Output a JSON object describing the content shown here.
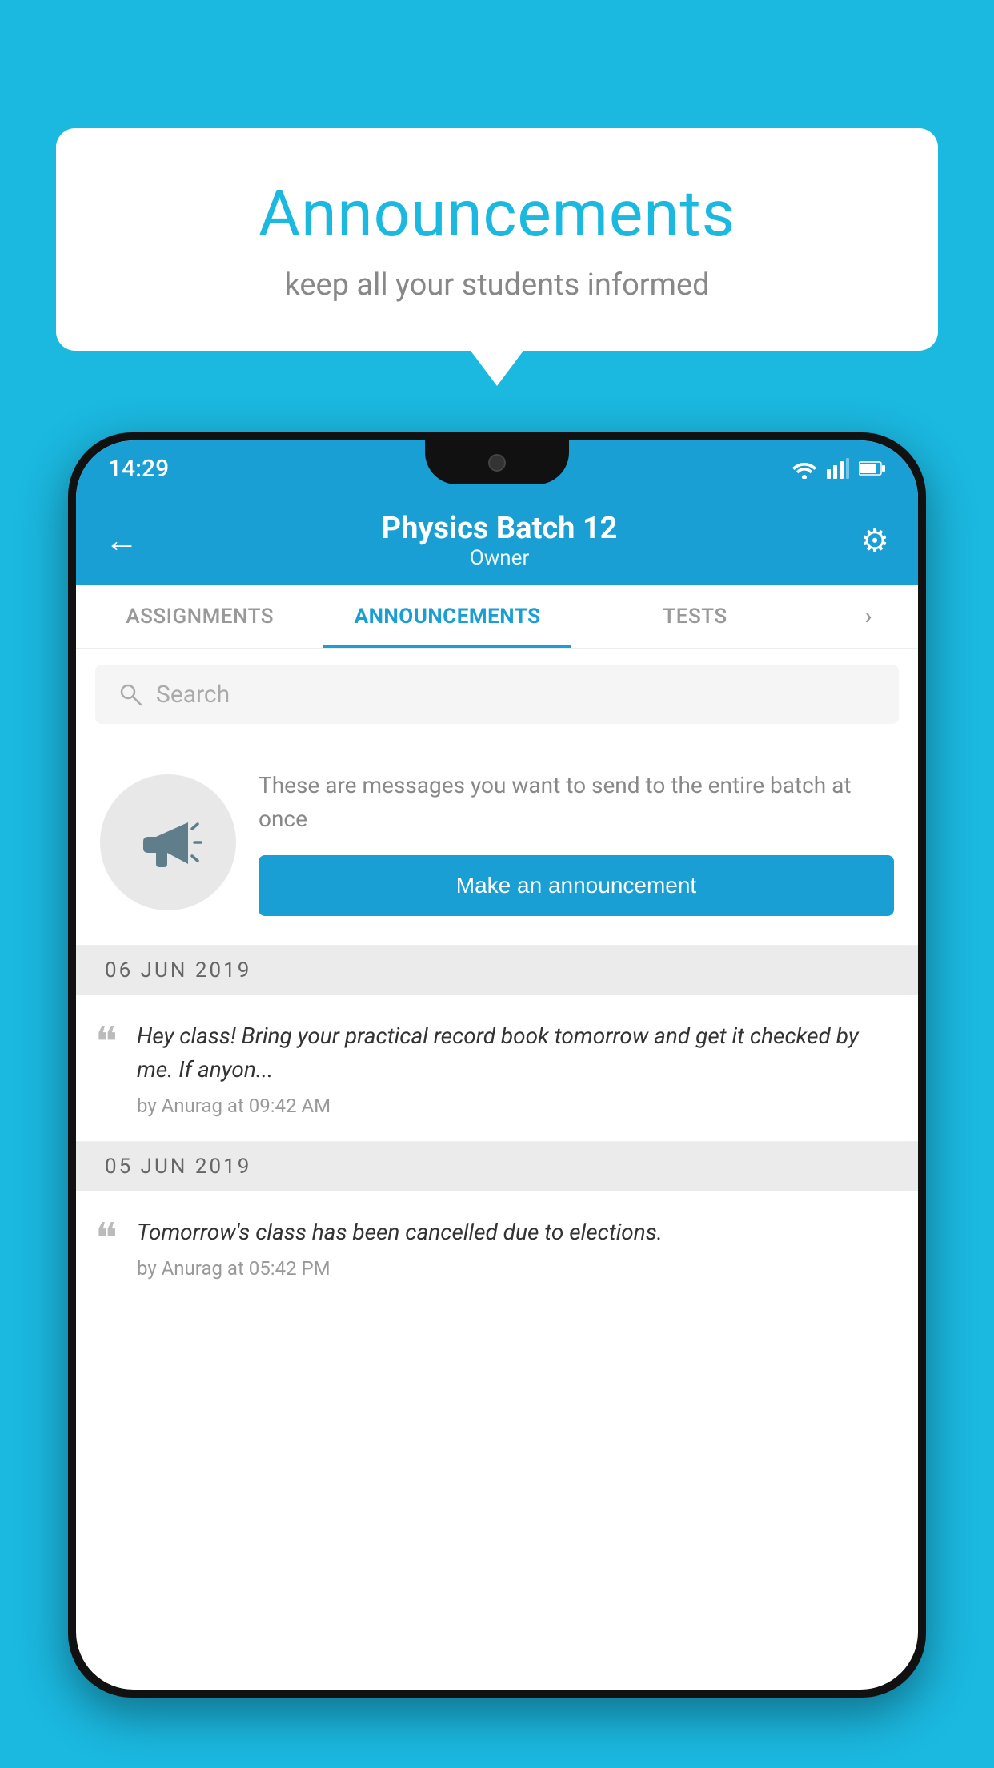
{
  "page": {
    "background_color": "#1BB8E0"
  },
  "speech_bubble": {
    "title": "Announcements",
    "subtitle": "keep all your students informed"
  },
  "phone": {
    "status_bar": {
      "time": "14:29",
      "icons": [
        "wifi",
        "signal",
        "battery"
      ]
    },
    "header": {
      "title": "Physics Batch 12",
      "subtitle": "Owner",
      "back_label": "←",
      "settings_label": "⚙"
    },
    "tabs": [
      {
        "label": "ASSIGNMENTS",
        "active": false
      },
      {
        "label": "ANNOUNCEMENTS",
        "active": true
      },
      {
        "label": "TESTS",
        "active": false
      },
      {
        "label": "›",
        "active": false
      }
    ],
    "search": {
      "placeholder": "Search"
    },
    "promo": {
      "description": "These are messages you want to send to the entire batch at once",
      "button_label": "Make an announcement"
    },
    "announcements": [
      {
        "date": "06  JUN  2019",
        "items": [
          {
            "text": "Hey class! Bring your practical record book tomorrow and get it checked by me. If anyon...",
            "meta": "by Anurag at 09:42 AM"
          }
        ]
      },
      {
        "date": "05  JUN  2019",
        "items": [
          {
            "text": "Tomorrow's class has been cancelled due to elections.",
            "meta": "by Anurag at 05:42 PM"
          }
        ]
      }
    ]
  }
}
